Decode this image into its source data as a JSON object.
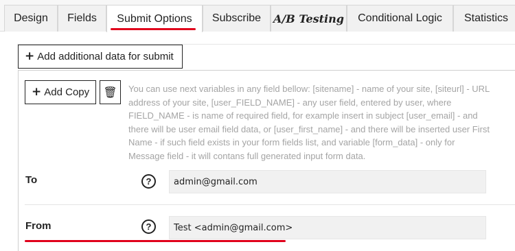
{
  "tabs": [
    {
      "label": "Design"
    },
    {
      "label": "Fields"
    },
    {
      "label": "Submit Options",
      "active": true
    },
    {
      "label": "Subscribe"
    },
    {
      "label": "A/B Testing"
    },
    {
      "label": "Conditional Logic"
    },
    {
      "label": "Statistics"
    }
  ],
  "accent_color": "#e0001b",
  "buttons": {
    "add_data_label": "Add additional data for submit",
    "add_copy_label": "Add Copy",
    "plus_icon": "+",
    "trash_icon": "🗑"
  },
  "hint": "You can use next variables in any field bellow: [sitename] - name of your site, [siteurl] - URL address of your site, [user_FIELD_NAME] - any user field, entered by user, where FIELD_NAME - is name of required field, for example insert in subject [user_email] - and there will be user email field data, or [user_first_name] - and there will be inserted user First Name - if such field exists in your form fields list, and variable [form_data] - only for Message field - it will contans full generated input form data.",
  "fields": {
    "to": {
      "label": "To",
      "value": "admin@gmail.com",
      "help": "?"
    },
    "from": {
      "label": "From",
      "value": "Test <admin@gmail.com>",
      "help": "?"
    }
  }
}
